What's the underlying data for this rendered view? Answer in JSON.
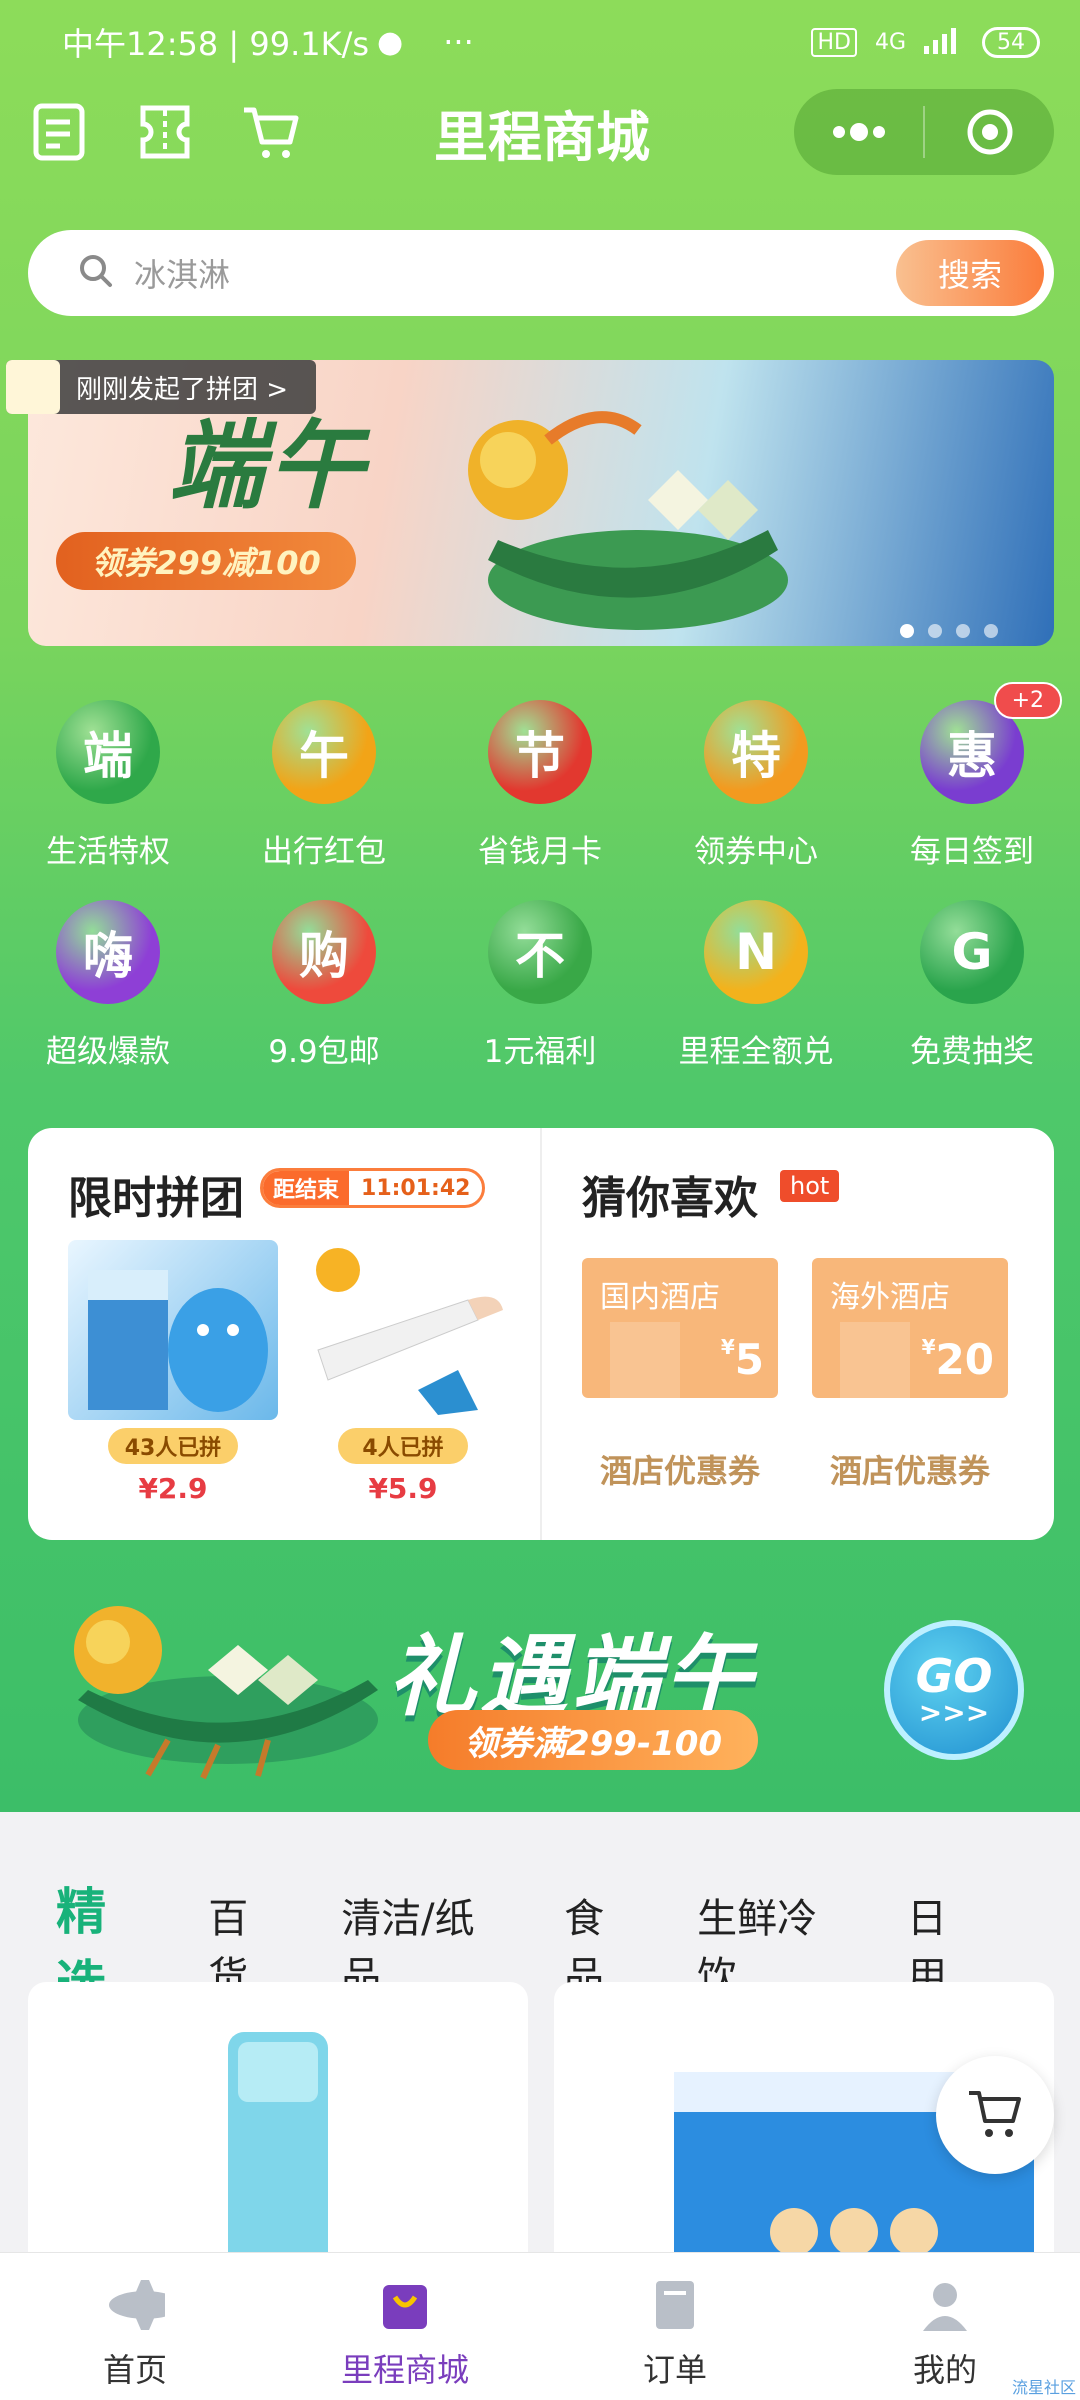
{
  "status_bar": {
    "time": "中午12:58 | 99.1K/s",
    "dots": "···",
    "hd": "HD",
    "network": "4G",
    "battery": "54"
  },
  "header": {
    "title": "里程商城"
  },
  "search": {
    "placeholder": "冰淇淋",
    "button": "搜索"
  },
  "banner": {
    "title": "端午",
    "coupon": "领券299减100",
    "tip": "刚刚发起了拼团 >"
  },
  "grid": [
    {
      "label": "生活特权",
      "glyph": "端",
      "color": "#2fa84a"
    },
    {
      "label": "出行红包",
      "glyph": "午",
      "color": "#f2a417"
    },
    {
      "label": "省钱月卡",
      "glyph": "节",
      "color": "#e2382f"
    },
    {
      "label": "领券中心",
      "glyph": "特",
      "color": "#f39a1f"
    },
    {
      "label": "每日签到",
      "glyph": "惠",
      "color": "#7a3dd0",
      "badge": "+2"
    },
    {
      "label": "超级爆款",
      "glyph": "嗨",
      "color": "#8e3fd6"
    },
    {
      "label": "9.9包邮",
      "glyph": "购",
      "color": "#ee4a3c"
    },
    {
      "label": "1元福利",
      "glyph": "不",
      "color": "#39a847"
    },
    {
      "label": "里程全额兑",
      "glyph": "N",
      "color": "#f3b21c"
    },
    {
      "label": "免费抽奖",
      "glyph": "G",
      "color": "#2aa44c"
    }
  ],
  "flash_group": {
    "title": "限时拼团",
    "countdown_label": "距结束",
    "countdown": "11:01:42",
    "products": [
      {
        "joined": "43人已拼",
        "price": "¥2.9"
      },
      {
        "joined": "4人已拼",
        "price": "¥5.9"
      }
    ]
  },
  "guess": {
    "title": "猜你喜欢",
    "hot": "hot",
    "tickets": [
      {
        "name": "国内酒店",
        "currency": "¥",
        "value": "5",
        "label": "酒店优惠券"
      },
      {
        "name": "海外酒店",
        "currency": "¥",
        "value": "20",
        "label": "酒店优惠券"
      }
    ]
  },
  "promo": {
    "title": "礼遇端午",
    "sub": "领券满299-100",
    "go": "GO",
    "arrows": ">>>"
  },
  "tabs": [
    "精选",
    "百货",
    "清洁/纸品",
    "食品",
    "生鲜冷饮",
    "日用"
  ],
  "bottom_nav": [
    {
      "label": "首页",
      "icon": "airplane-icon"
    },
    {
      "label": "里程商城",
      "icon": "shopping-bag-icon",
      "active": true
    },
    {
      "label": "订单",
      "icon": "order-book-icon"
    },
    {
      "label": "我的",
      "icon": "profile-icon"
    }
  ],
  "watermark": "流星社区"
}
